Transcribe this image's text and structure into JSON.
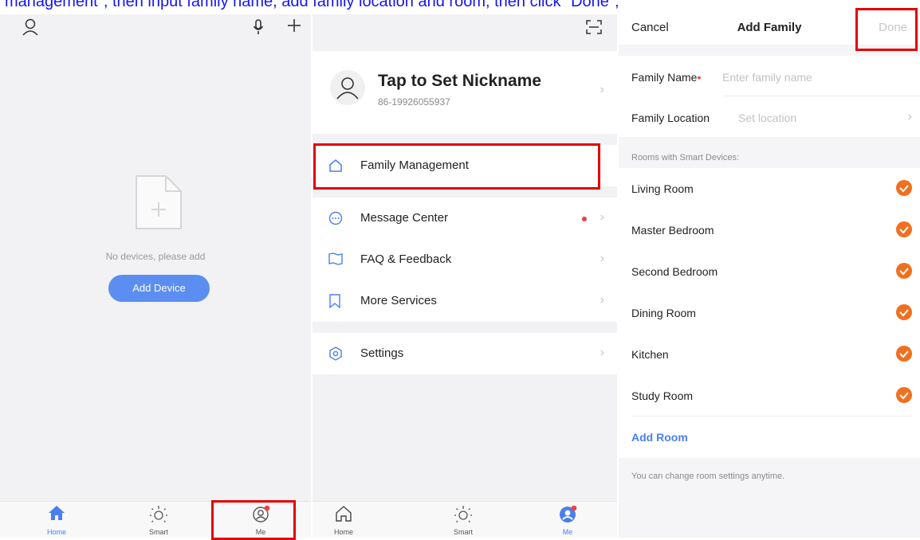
{
  "caption": "management\", then input family name, add family location and room, then click \"Done\";",
  "home": {
    "empty_text": "No devices, please add",
    "add_device": "Add Device",
    "tabs": [
      {
        "label": "Home",
        "active": true
      },
      {
        "label": "Smart",
        "active": false
      },
      {
        "label": "Me",
        "active": false
      }
    ]
  },
  "me": {
    "nickname": "Tap to Set Nickname",
    "phone": "86-19926055937",
    "menu": [
      {
        "label": "Family Management",
        "icon": "home-outline-icon"
      },
      {
        "label": "Message Center",
        "icon": "chat-bubble-icon",
        "badge": true
      },
      {
        "label": "FAQ & Feedback",
        "icon": "book-icon"
      },
      {
        "label": "More Services",
        "icon": "bookmark-icon"
      },
      {
        "label": "Settings",
        "icon": "gear-icon"
      }
    ],
    "tabs": [
      {
        "label": "Home",
        "active": false
      },
      {
        "label": "Smart",
        "active": false
      },
      {
        "label": "Me",
        "active": true
      }
    ]
  },
  "add_family": {
    "cancel": "Cancel",
    "title": "Add Family",
    "done": "Done",
    "family_name_label": "Family Name",
    "family_name_placeholder": "Enter family name",
    "family_location_label": "Family Location",
    "family_location_placeholder": "Set location",
    "rooms_header": "Rooms with Smart Devices:",
    "rooms": [
      {
        "name": "Living Room",
        "checked": true
      },
      {
        "name": "Master Bedroom",
        "checked": true
      },
      {
        "name": "Second Bedroom",
        "checked": true
      },
      {
        "name": "Dining Room",
        "checked": true
      },
      {
        "name": "Kitchen",
        "checked": true
      },
      {
        "name": "Study Room",
        "checked": true
      }
    ],
    "add_room": "Add Room",
    "footer_note": "You can change room settings anytime."
  },
  "colors": {
    "accent_blue": "#4a7ff0",
    "check_orange": "#f0701f",
    "highlight_red": "#e30000",
    "required_red": "#f04040"
  }
}
